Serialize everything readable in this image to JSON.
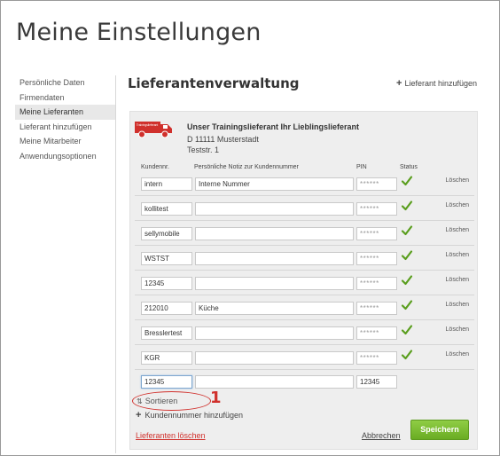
{
  "page": {
    "title": "Meine Einstellungen"
  },
  "sidebar": {
    "items": [
      {
        "label": "Persönliche Daten",
        "active": false
      },
      {
        "label": "Firmendaten",
        "active": false
      },
      {
        "label": "Meine Lieferanten",
        "active": true
      },
      {
        "label": "Lieferant hinzufügen",
        "active": false
      },
      {
        "label": "Meine Mitarbeiter",
        "active": false
      },
      {
        "label": "Anwendungsoptionen",
        "active": false
      }
    ]
  },
  "main": {
    "title": "Lieferantenverwaltung",
    "add_supplier_label": "Lieferant hinzufügen"
  },
  "supplier": {
    "logo_text": "Trainingslieferant",
    "name": "Unser Trainingslieferant Ihr Lieblingslieferant",
    "address_line1": "D 11111 Musterstadt",
    "address_line2": "Teststr. 1"
  },
  "table": {
    "headers": {
      "customer_number": "Kundennr.",
      "note": "Persönliche Notiz zur Kundennummer",
      "pin": "PIN",
      "status": "Status"
    },
    "delete_label": "Löschen",
    "rows": [
      {
        "customer_number": "intern",
        "note": "Interne Nummer",
        "pin": "******",
        "status_ok": true
      },
      {
        "customer_number": "kollitest",
        "note": "",
        "pin": "******",
        "status_ok": true
      },
      {
        "customer_number": "sellymobile",
        "note": "",
        "pin": "******",
        "status_ok": true
      },
      {
        "customer_number": "WSTST",
        "note": "",
        "pin": "******",
        "status_ok": true
      },
      {
        "customer_number": "12345",
        "note": "",
        "pin": "******",
        "status_ok": true
      },
      {
        "customer_number": "212010",
        "note": "Küche",
        "pin": "******",
        "status_ok": true
      },
      {
        "customer_number": "Bresslertest",
        "note": "",
        "pin": "******",
        "status_ok": true
      },
      {
        "customer_number": "KGR",
        "note": "",
        "pin": "******",
        "status_ok": true
      }
    ],
    "new_row": {
      "customer_number": "12345",
      "note": "",
      "pin": "12345"
    }
  },
  "actions": {
    "sort_label": "Sortieren",
    "add_number_label": "Kundennummer hinzufügen",
    "delete_suppliers_label": "Lieferanten löschen",
    "cancel_label": "Abbrechen",
    "save_label": "Speichern"
  },
  "annotation": {
    "marker": "1"
  },
  "colors": {
    "accent_red": "#d0302c",
    "status_green": "#5a9e1e",
    "save_green": "#7abf32",
    "panel_bg": "#eeeeee"
  },
  "icons": {
    "truck": "truck-icon",
    "check": "checkmark-icon",
    "sort": "sort-icon",
    "plus": "plus-icon"
  }
}
